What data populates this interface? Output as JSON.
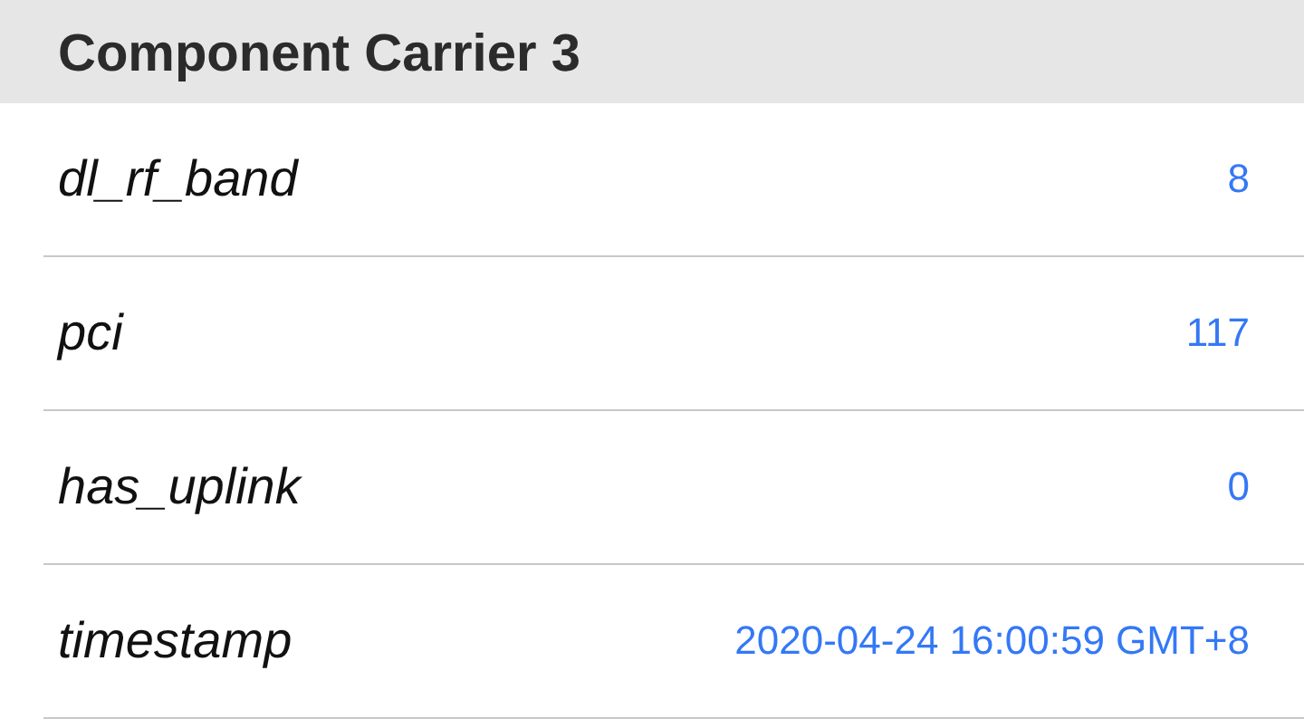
{
  "section": {
    "title": "Component Carrier 3"
  },
  "rows": [
    {
      "label": "dl_rf_band",
      "value": "8"
    },
    {
      "label": "pci",
      "value": "117"
    },
    {
      "label": "has_uplink",
      "value": "0"
    },
    {
      "label": "timestamp",
      "value": "2020-04-24 16:00:59 GMT+8"
    }
  ]
}
